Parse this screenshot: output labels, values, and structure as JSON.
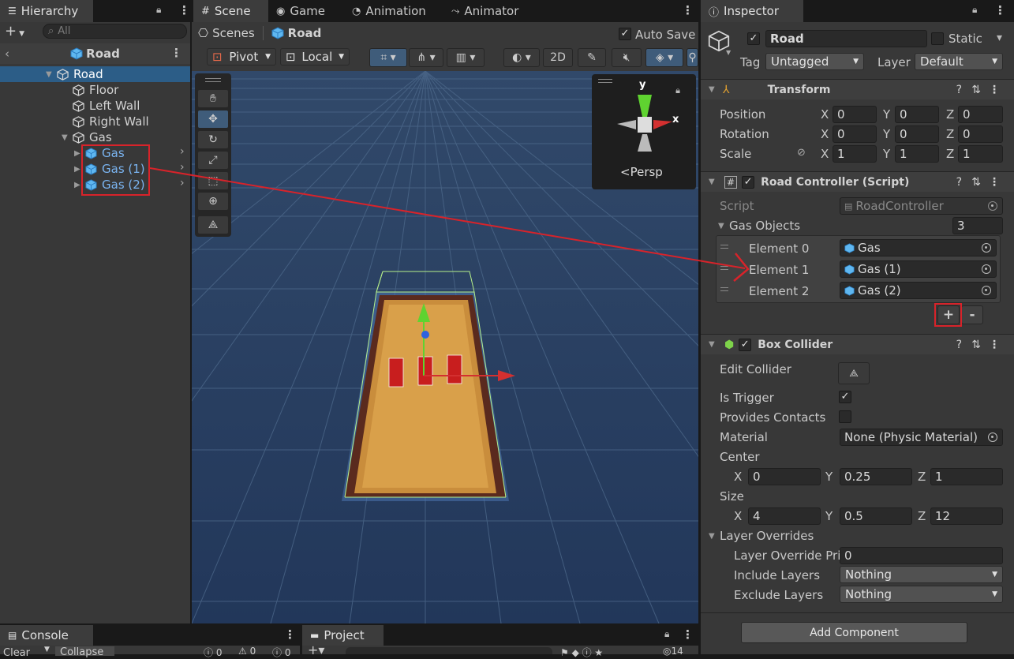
{
  "hierarchy": {
    "tab": "Hierarchy",
    "search_placeholder": "All",
    "scene_title": "Road",
    "items": [
      {
        "label": "Road"
      },
      {
        "label": "Floor"
      },
      {
        "label": "Left Wall"
      },
      {
        "label": "Right Wall"
      },
      {
        "label": "Gas"
      },
      {
        "label": "Gas"
      },
      {
        "label": "Gas (1)"
      },
      {
        "label": "Gas (2)"
      }
    ]
  },
  "center": {
    "tabs": [
      "Scene",
      "Game",
      "Animation",
      "Animator"
    ],
    "breadcrumb": {
      "root": "Scenes",
      "current": "Road"
    },
    "auto_save": "Auto Save",
    "pivot": "Pivot",
    "local": "Local",
    "mode_2d": "2D",
    "gizmo": {
      "y": "y",
      "x": "x",
      "persp": "Persp"
    }
  },
  "inspector": {
    "tab": "Inspector",
    "object_name": "Road",
    "static_label": "Static",
    "tag_label": "Tag",
    "tag_value": "Untagged",
    "layer_label": "Layer",
    "layer_value": "Default",
    "transform": {
      "title": "Transform",
      "position": {
        "label": "Position",
        "x": "0",
        "y": "0",
        "z": "0"
      },
      "rotation": {
        "label": "Rotation",
        "x": "0",
        "y": "0",
        "z": "0"
      },
      "scale": {
        "label": "Scale",
        "x": "1",
        "y": "1",
        "z": "1"
      },
      "axis_x": "X",
      "axis_y": "Y",
      "axis_z": "Z"
    },
    "road_controller": {
      "title": "Road Controller (Script)",
      "script_label": "Script",
      "script_value": "RoadController",
      "gas_objects_label": "Gas Objects",
      "gas_objects_count": "3",
      "elements": [
        {
          "label": "Element 0",
          "value": "Gas"
        },
        {
          "label": "Element 1",
          "value": "Gas (1)"
        },
        {
          "label": "Element 2",
          "value": "Gas (2)"
        }
      ],
      "add": "+",
      "remove": "-"
    },
    "box_collider": {
      "title": "Box Collider",
      "edit_collider": "Edit Collider",
      "is_trigger": "Is Trigger",
      "provides_contacts": "Provides Contacts",
      "material_label": "Material",
      "material_value": "None (Physic Material)",
      "center_label": "Center",
      "center": {
        "x": "0",
        "y": "0.25",
        "z": "1"
      },
      "size_label": "Size",
      "size": {
        "x": "4",
        "y": "0.5",
        "z": "12"
      },
      "layer_overrides": "Layer Overrides",
      "layer_override_priority_label": "Layer Override Pri",
      "layer_override_priority_value": "0",
      "include_layers_label": "Include Layers",
      "include_layers_value": "Nothing",
      "exclude_layers_label": "Exclude Layers",
      "exclude_layers_value": "Nothing"
    },
    "add_component": "Add Component"
  },
  "bottom": {
    "console_tab": "Console",
    "project_tab": "Project",
    "clear": "Clear",
    "collapse": "Collapse",
    "counts": [
      "0",
      "0",
      "0"
    ],
    "project_count": "14"
  },
  "colors": {
    "accent_select": "#2c5d87",
    "annotation_red": "#d8232a",
    "link_blue": "#7ab4f0"
  }
}
